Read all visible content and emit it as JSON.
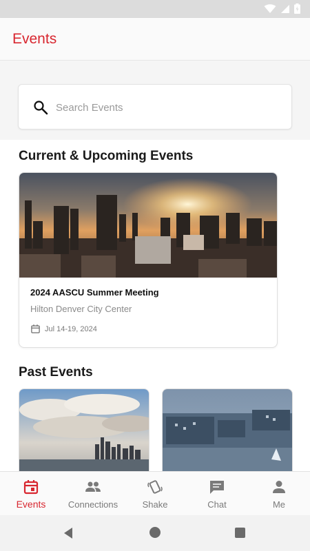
{
  "app": {
    "title": "Events"
  },
  "search": {
    "placeholder": "Search Events",
    "value": ""
  },
  "sections": {
    "current": "Current & Upcoming Events",
    "past": "Past Events"
  },
  "current_event": {
    "name": "2024 AASCU Summer Meeting",
    "venue": "Hilton Denver City Center",
    "date": "Jul 14-19, 2024"
  },
  "bottom_nav": [
    {
      "label": "Events",
      "icon": "calendar-icon",
      "active": true
    },
    {
      "label": "Connections",
      "icon": "people-icon",
      "active": false
    },
    {
      "label": "Shake",
      "icon": "shake-icon",
      "active": false
    },
    {
      "label": "Chat",
      "icon": "chat-icon",
      "active": false
    },
    {
      "label": "Me",
      "icon": "person-icon",
      "active": false
    }
  ],
  "colors": {
    "accent": "#d8262f",
    "inactive": "#7a7a7a"
  }
}
